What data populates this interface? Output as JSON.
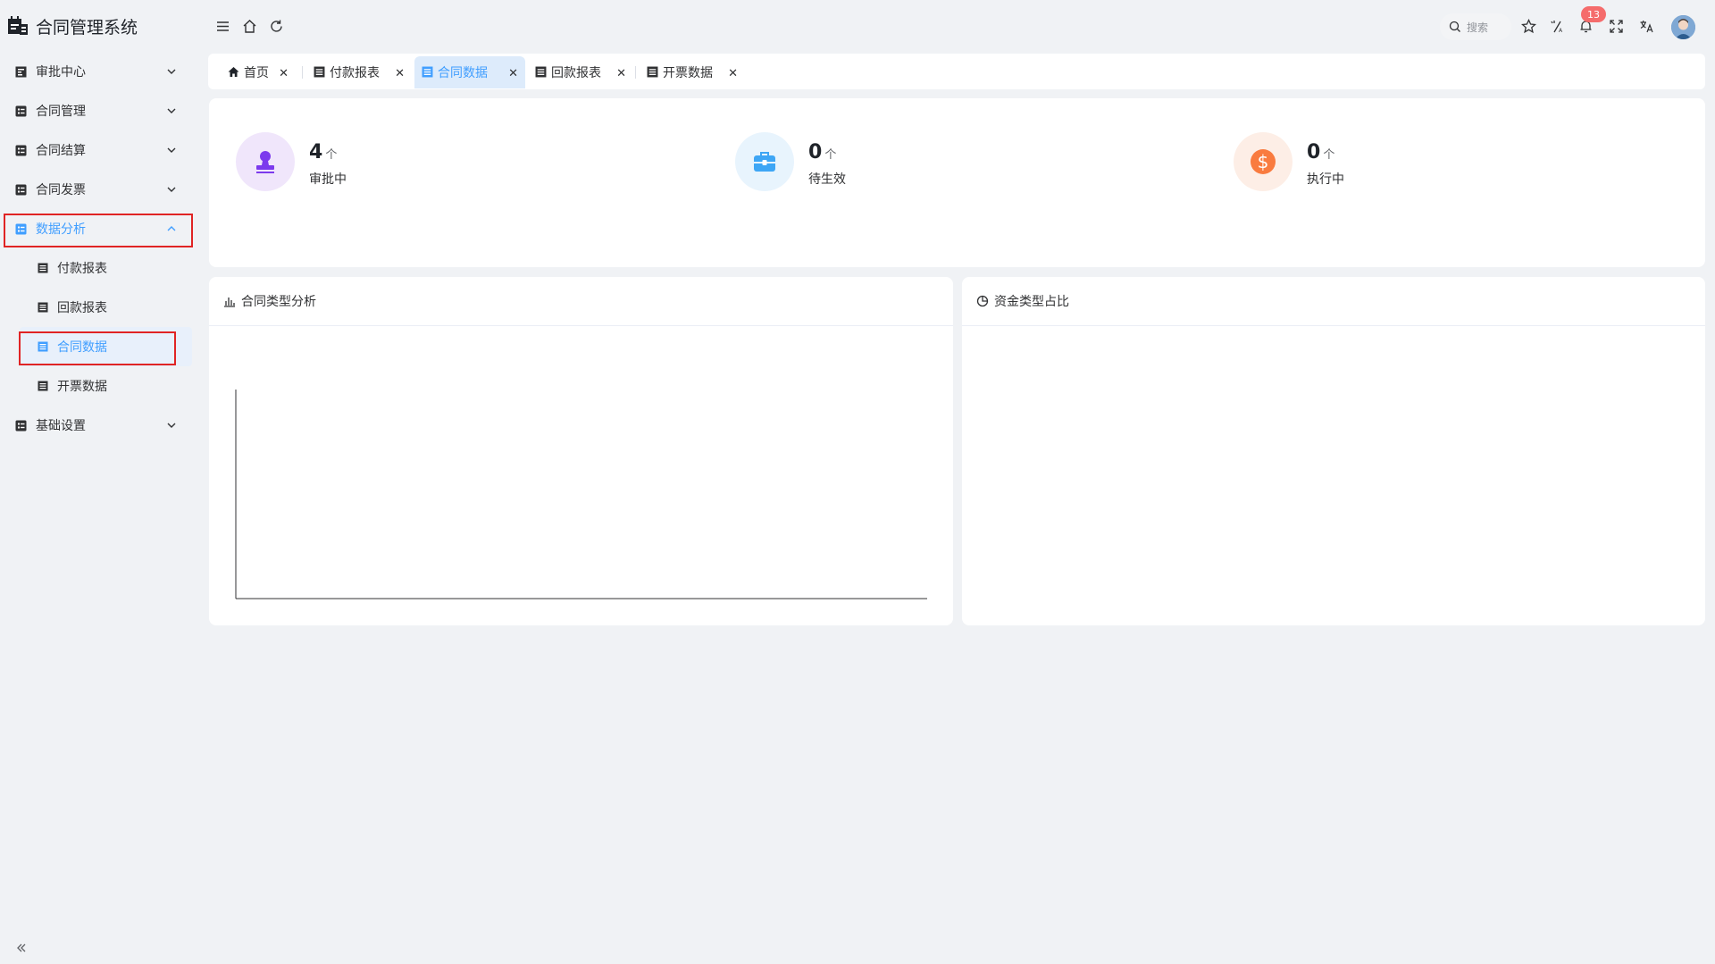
{
  "app": {
    "title": "合同管理系统"
  },
  "sidebar": {
    "items": [
      {
        "label": "审批中心",
        "expanded": false
      },
      {
        "label": "合同管理",
        "expanded": false
      },
      {
        "label": "合同结算",
        "expanded": false
      },
      {
        "label": "合同发票",
        "expanded": false
      },
      {
        "label": "数据分析",
        "expanded": true,
        "children": [
          {
            "label": "付款报表"
          },
          {
            "label": "回款报表"
          },
          {
            "label": "合同数据",
            "active": true
          },
          {
            "label": "开票数据"
          }
        ]
      },
      {
        "label": "基础设置",
        "expanded": false
      }
    ]
  },
  "header": {
    "search_placeholder": "搜索",
    "notification_count": "13",
    "icons": [
      "menu-fold-icon",
      "home-icon",
      "refresh-icon",
      "search-icon",
      "star-icon",
      "translate-symbol-icon",
      "bell-icon",
      "fullscreen-icon",
      "language-icon",
      "avatar"
    ]
  },
  "tabs": [
    {
      "label": "首页",
      "icon": "home-icon",
      "active": false
    },
    {
      "label": "付款报表",
      "icon": "document-icon",
      "active": false
    },
    {
      "label": "合同数据",
      "icon": "document-icon",
      "active": true
    },
    {
      "label": "回款报表",
      "icon": "document-icon",
      "active": false
    },
    {
      "label": "开票数据",
      "icon": "document-icon",
      "active": false
    }
  ],
  "stats": [
    {
      "value": "4",
      "unit": "个",
      "label": "审批中",
      "icon": "stamp-icon",
      "color": "#7c3aed",
      "bg": "#f0e6fb"
    },
    {
      "value": "0",
      "unit": "个",
      "label": "待生效",
      "icon": "briefcase-icon",
      "color": "#3ea6f5",
      "bg": "#e8f4fd"
    },
    {
      "value": "0",
      "unit": "个",
      "label": "执行中",
      "icon": "dollar-icon",
      "color": "#f97b3f",
      "bg": "#fdeee6"
    }
  ],
  "cards": {
    "contract_type": {
      "title": "合同类型分析",
      "icon": "bar-chart-icon"
    },
    "fund_type": {
      "title": "资金类型占比",
      "icon": "pie-chart-icon"
    }
  },
  "chart_data": [
    {
      "type": "bar",
      "title": "合同类型分析",
      "categories": [],
      "values": []
    },
    {
      "type": "pie",
      "title": "资金类型占比",
      "values": []
    }
  ],
  "colors": {
    "accent": "#409eff",
    "highlight_box": "#e02424",
    "badge": "#f56c6c"
  }
}
